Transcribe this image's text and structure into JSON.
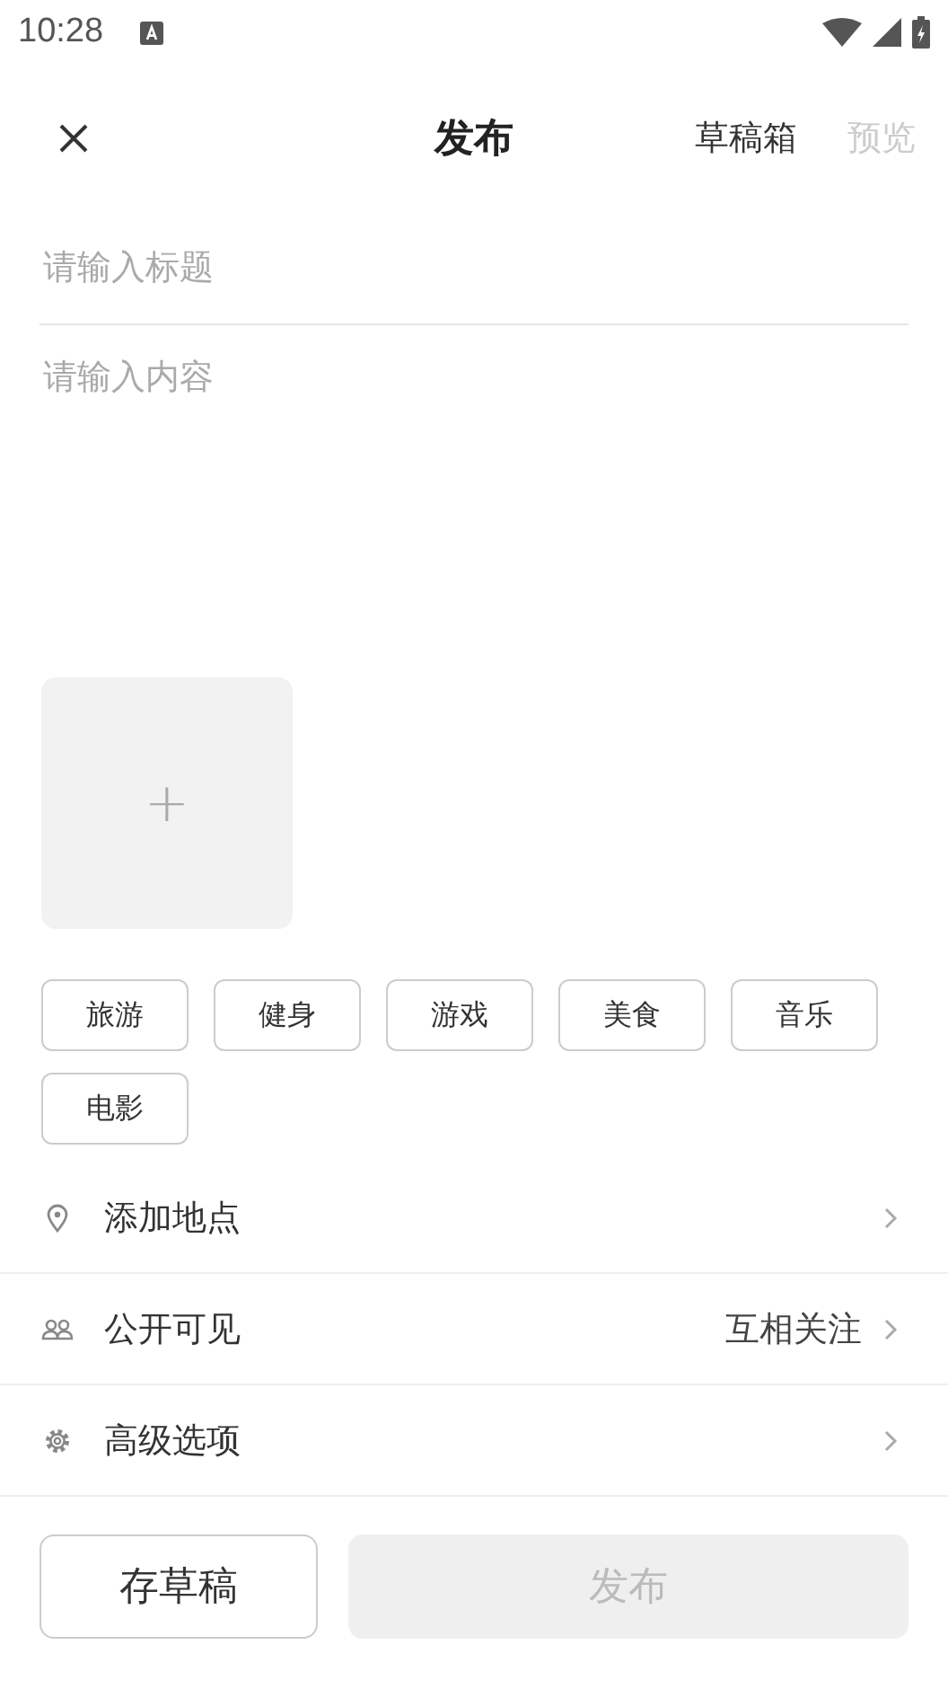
{
  "status_bar": {
    "time": "10:28"
  },
  "header": {
    "title": "发布",
    "actions": [
      {
        "label": "草稿箱",
        "disabled": false
      },
      {
        "label": "预览",
        "disabled": true
      }
    ]
  },
  "title_field": {
    "placeholder": "请输入标题"
  },
  "content_field": {
    "placeholder": "请输入内容"
  },
  "add_image": {
    "label": "+"
  },
  "tags": [
    "旅游",
    "健身",
    "游戏",
    "美食",
    "音乐",
    "电影"
  ],
  "options": [
    {
      "kind": "location",
      "label": "添加地点"
    },
    {
      "kind": "visibility",
      "label": "公开可见",
      "value": "互相关注"
    },
    {
      "kind": "advanced",
      "label": "高级选项"
    }
  ],
  "bottom": {
    "draft_button": "存草稿",
    "publish_button": {
      "label": "发布",
      "disabled": true
    }
  }
}
